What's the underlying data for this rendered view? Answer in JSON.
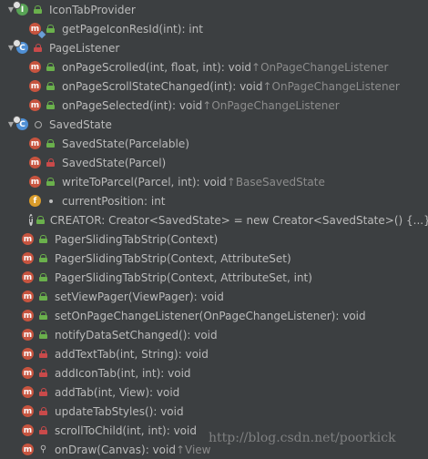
{
  "items": [
    {
      "depth": 0,
      "expanded": true,
      "icon": "interface-icon",
      "vis": "public",
      "text": "IconTabProvider",
      "suffix": ""
    },
    {
      "depth": 1,
      "icon": "method-abstract-icon",
      "vis": "public",
      "text": "getPageIconResId(int): int",
      "suffix": ""
    },
    {
      "depth": 0,
      "expanded": true,
      "icon": "class-icon",
      "vis": "private",
      "text": "PageListener",
      "suffix": ""
    },
    {
      "depth": 1,
      "icon": "method-icon",
      "vis": "public",
      "text": "onPageScrolled(int, float, int): void ",
      "suffix": "↑OnPageChangeListener"
    },
    {
      "depth": 1,
      "icon": "method-icon",
      "vis": "public",
      "text": "onPageScrollStateChanged(int): void ",
      "suffix": "↑OnPageChangeListener"
    },
    {
      "depth": 1,
      "icon": "method-icon",
      "vis": "public",
      "text": "onPageSelected(int): void ",
      "suffix": "↑OnPageChangeListener"
    },
    {
      "depth": 0,
      "expanded": true,
      "icon": "class-icon",
      "vis": "package",
      "text": "SavedState",
      "suffix": ""
    },
    {
      "depth": 1,
      "icon": "method-icon",
      "vis": "public",
      "text": "SavedState(Parcelable)",
      "suffix": ""
    },
    {
      "depth": 1,
      "icon": "method-icon",
      "vis": "private",
      "text": "SavedState(Parcel)",
      "suffix": ""
    },
    {
      "depth": 1,
      "icon": "method-icon",
      "vis": "public",
      "text": "writeToParcel(Parcel, int): void ",
      "suffix": "↑BaseSavedState"
    },
    {
      "depth": 1,
      "icon": "field-icon",
      "vis": "package-dot",
      "text": "currentPosition: int",
      "suffix": ""
    },
    {
      "depth": 1,
      "icon": "static-field-icon",
      "vis": "public",
      "text": "CREATOR: Creator<SavedState> = new Creator<SavedState>() {...}",
      "suffix": ""
    },
    {
      "depth": 0,
      "icon": "method-icon",
      "vis": "public",
      "text": "PagerSlidingTabStrip(Context)",
      "suffix": ""
    },
    {
      "depth": 0,
      "icon": "method-icon",
      "vis": "public",
      "text": "PagerSlidingTabStrip(Context, AttributeSet)",
      "suffix": ""
    },
    {
      "depth": 0,
      "icon": "method-icon",
      "vis": "public",
      "text": "PagerSlidingTabStrip(Context, AttributeSet, int)",
      "suffix": ""
    },
    {
      "depth": 0,
      "icon": "method-icon",
      "vis": "public",
      "text": "setViewPager(ViewPager): void",
      "suffix": ""
    },
    {
      "depth": 0,
      "icon": "method-icon",
      "vis": "public",
      "text": "setOnPageChangeListener(OnPageChangeListener): void",
      "suffix": ""
    },
    {
      "depth": 0,
      "icon": "method-icon",
      "vis": "public",
      "text": "notifyDataSetChanged(): void",
      "suffix": ""
    },
    {
      "depth": 0,
      "icon": "method-icon",
      "vis": "private",
      "text": "addTextTab(int, String): void",
      "suffix": ""
    },
    {
      "depth": 0,
      "icon": "method-icon",
      "vis": "private",
      "text": "addIconTab(int, int): void",
      "suffix": ""
    },
    {
      "depth": 0,
      "icon": "method-icon",
      "vis": "private",
      "text": "addTab(int, View): void",
      "suffix": ""
    },
    {
      "depth": 0,
      "icon": "method-icon",
      "vis": "private",
      "text": "updateTabStyles(): void",
      "suffix": ""
    },
    {
      "depth": 0,
      "icon": "method-icon",
      "vis": "private",
      "text": "scrollToChild(int, int): void",
      "suffix": ""
    },
    {
      "depth": 0,
      "icon": "method-icon",
      "vis": "protected",
      "text": "onDraw(Canvas): void ",
      "suffix": "↑View"
    }
  ],
  "watermark": "http://blog.csdn.net/poorkick",
  "colors": {
    "background": "#3c3f41",
    "text": "#bbbbbb",
    "suffix": "#8c8c8c",
    "method": "#c7543f",
    "class": "#4f8fd4",
    "interface": "#58a355",
    "field": "#d99b2a"
  }
}
